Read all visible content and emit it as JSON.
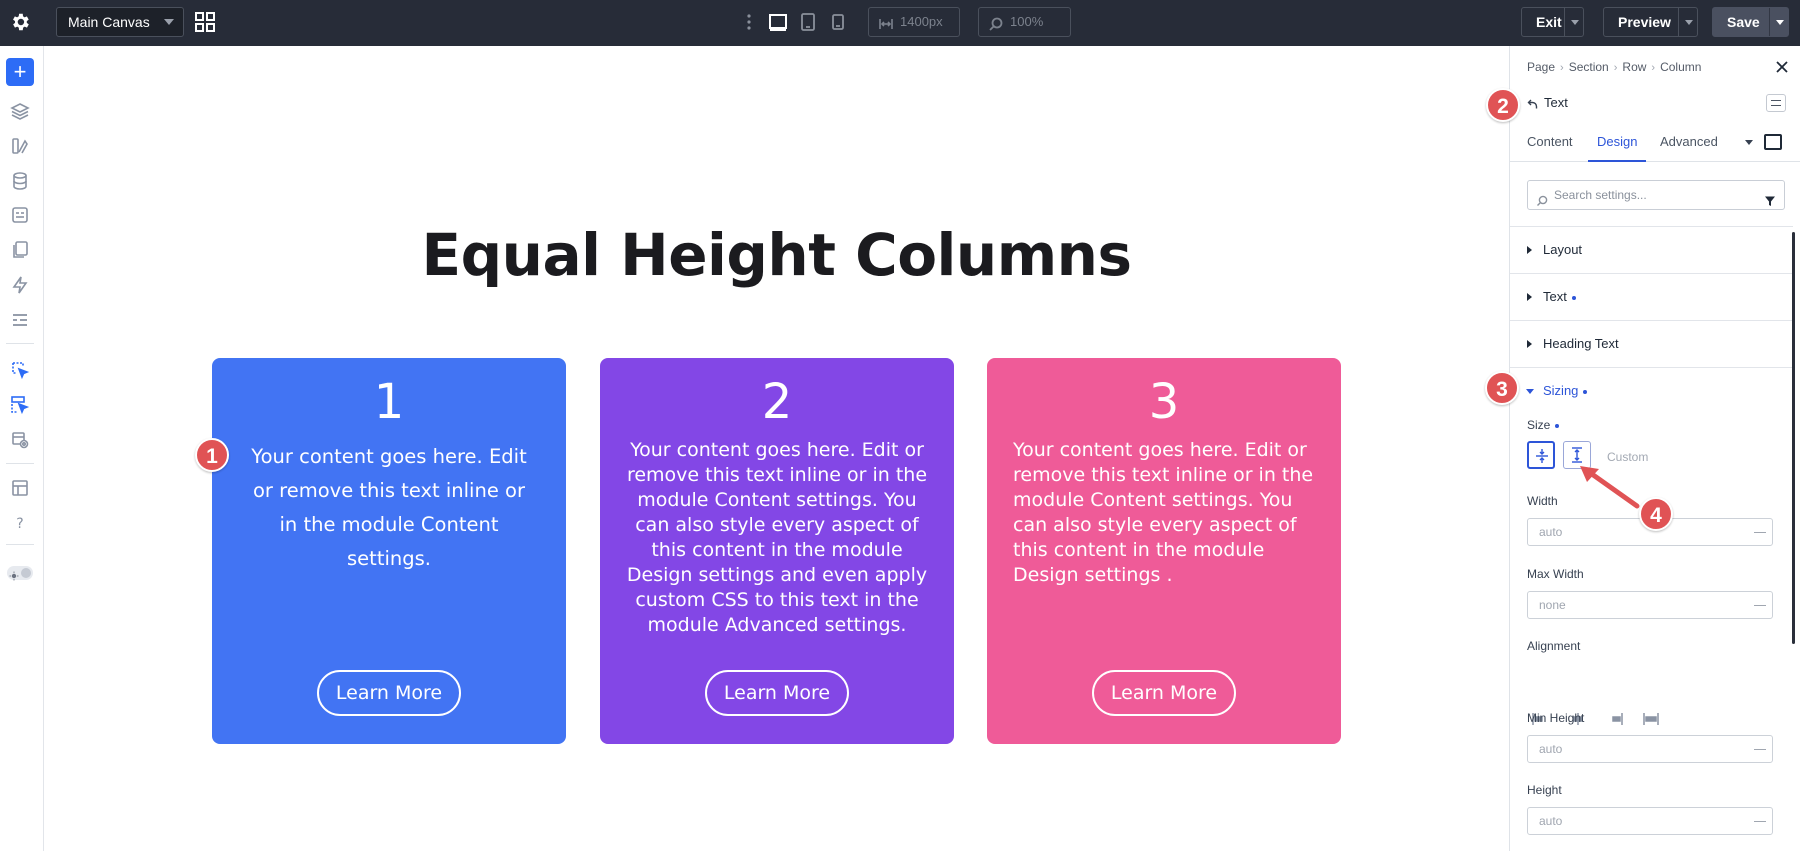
{
  "topbar": {
    "canvas_name": "Main Canvas",
    "width_value": "1400px",
    "zoom_value": "100%",
    "exit_label": "Exit",
    "preview_label": "Preview",
    "save_label": "Save"
  },
  "canvas": {
    "title": "Equal Height Columns",
    "cards": [
      {
        "number": "1",
        "text": "Your content goes here. Edit or remove this text inline or in the module Content settings.",
        "button": "Learn More",
        "color": "#4274f3"
      },
      {
        "number": "2",
        "text": "Your content goes here. Edit or remove this text inline or in the module Content settings. You can also style every aspect of this content in the module Design settings and even apply custom CSS to this text in the module Advanced settings.",
        "button": "Learn More",
        "color": "#8347e6"
      },
      {
        "number": "3",
        "text": "Your content goes here. Edit or remove this text inline or in the module Content settings. You can also style every aspect of this content in the module Design settings .",
        "button": "Learn More",
        "color": "#ef5b98"
      }
    ]
  },
  "markers": [
    "1",
    "2",
    "3",
    "4"
  ],
  "panel": {
    "breadcrumbs": [
      "Page",
      "Section",
      "Row",
      "Column"
    ],
    "module_title": "Text",
    "tabs": [
      "Content",
      "Design",
      "Advanced"
    ],
    "active_tab": "Design",
    "search_placeholder": "Search settings...",
    "sections": [
      "Layout",
      "Text",
      "Heading Text",
      "Sizing"
    ],
    "size_label": "Size",
    "custom_label": "Custom",
    "fields": [
      {
        "label": "Width",
        "value": "auto"
      },
      {
        "label": "Max Width",
        "value": "none"
      },
      {
        "label": "Alignment",
        "value": ""
      },
      {
        "label": "Min Height",
        "value": "auto"
      },
      {
        "label": "Height",
        "value": "auto"
      }
    ]
  },
  "colors": {
    "accent": "#2d6cf6",
    "marker": "#e05355",
    "topbar": "#272c38"
  }
}
